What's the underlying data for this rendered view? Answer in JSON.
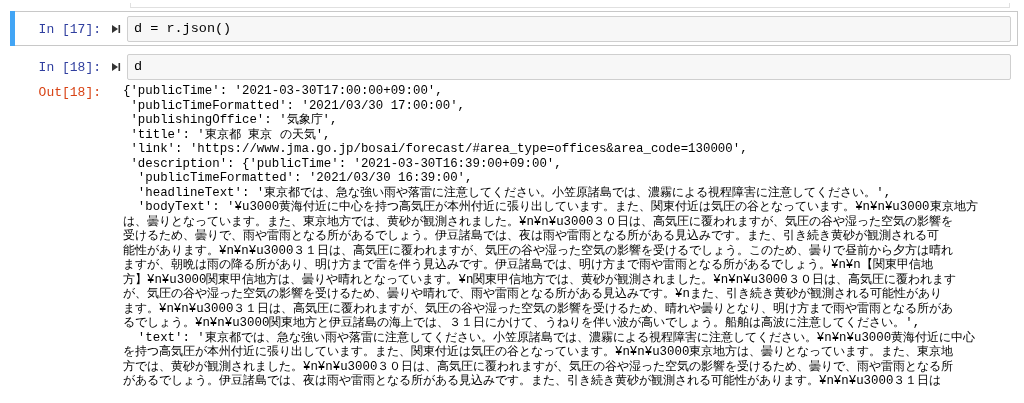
{
  "cells": [
    {
      "prompt": "In [17]:",
      "source": "d = r.json()",
      "selected": true
    },
    {
      "prompt": "In [18]:",
      "source": "d",
      "selected": false,
      "output": {
        "prompt": "Out[18]:",
        "lines": [
          "{'publicTime': '2021-03-30T17:00:00+09:00',",
          " 'publicTimeFormatted': '2021/03/30 17:00:00',",
          " 'publishingOffice': '気象庁',",
          " 'title': '東京都 東京 の天気',",
          " 'link': 'https://www.jma.go.jp/bosai/forecast/#area_type=offices&area_code=130000',",
          " 'description': {'publicTime': '2021-03-30T16:39:00+09:00',",
          "  'publicTimeFormatted': '2021/03/30 16:39:00',",
          "  'headlineText': '東京都では、急な強い雨や落雷に注意してください。小笠原諸島では、濃霧による視程障害に注意してください。',",
          "  'bodyText': '¥u3000黄海付近に中心を持つ高気圧が本州付近に張り出しています。また、関東付近は気圧の谷となっています。¥n¥n¥u3000東京地方",
          "は、曇りとなっています。また、東京地方では、黄砂が観測されました。¥n¥n¥u3000３０日は、高気圧に覆われますが、気圧の谷や湿った空気の影響を",
          "受けるため、曇りで、雨や雷雨となる所があるでしょう。伊豆諸島では、夜は雨や雷雨となる所がある見込みです。また、引き続き黄砂が観測される可",
          "能性があります。¥n¥n¥u3000３１日は、高気圧に覆われますが、気圧の谷や湿った空気の影響を受けるでしょう。このため、曇りで昼前から夕方は晴れ",
          "ますが、朝晩は雨の降る所があり、明け方まで雷を伴う見込みです。伊豆諸島では、明け方まで雨や雷雨となる所があるでしょう。¥n¥n【関東甲信地",
          "方】¥n¥u3000関東甲信地方は、曇りや晴れとなっています。¥n関東甲信地方では、黄砂が観測されました。¥n¥n¥u3000３０日は、高気圧に覆われます",
          "が、気圧の谷や湿った空気の影響を受けるため、曇りや晴れで、雨や雷雨となる所がある見込みです。¥nまた、引き続き黄砂が観測される可能性があり",
          "ます。¥n¥n¥u3000３１日は、高気圧に覆われますが、気圧の谷や湿った空気の影響を受けるため、晴れや曇りとなり、明け方まで雨や雷雨となる所があ",
          "るでしょう。¥n¥n¥u3000関東地方と伊豆諸島の海上では、３１日にかけて、うねりを伴い波が高いでしょう。船舶は高波に注意してください。',",
          "  'text': '東京都では、急な強い雨や落雷に注意してください。小笠原諸島では、濃霧による視程障害に注意してください。¥n¥n¥u3000黄海付近に中心",
          "を持つ高気圧が本州付近に張り出しています。また、関東付近は気圧の谷となっています。¥n¥n¥u3000東京地方は、曇りとなっています。また、東京地",
          "方では、黄砂が観測されました。¥n¥n¥u3000３０日は、高気圧に覆われますが、気圧の谷や湿った空気の影響を受けるため、曇りで、雨や雷雨となる所",
          "があるでしょう。伊豆諸島では、夜は雨や雷雨となる所がある見込みです。また、引き続き黄砂が観測される可能性があります。¥n¥n¥u3000３１日は"
        ]
      }
    }
  ]
}
